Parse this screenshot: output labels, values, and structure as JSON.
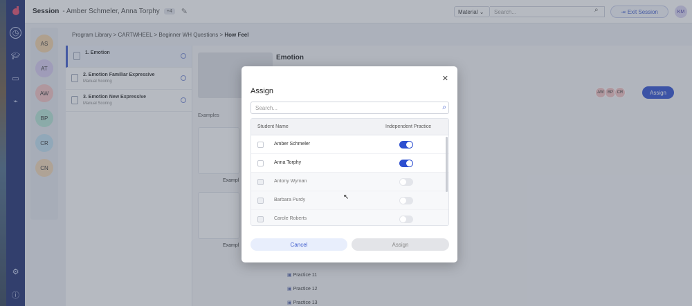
{
  "session": {
    "label": "Session",
    "students": "- Amber Schmeler, Anna Torphy",
    "extra": "+4"
  },
  "topbar": {
    "material": "Material",
    "search_placeholder": "Search...",
    "exit_label": "Exit Session",
    "user_initials": "KM"
  },
  "student_avatars": [
    {
      "initials": "AS",
      "color": "#f3d3a8"
    },
    {
      "initials": "AT",
      "color": "#d8ccf2"
    },
    {
      "initials": "AW",
      "color": "#f4c3c3"
    },
    {
      "initials": "BP",
      "color": "#b6e6d6"
    },
    {
      "initials": "CR",
      "color": "#bfe0f2"
    },
    {
      "initials": "CN",
      "color": "#f3d8b6"
    }
  ],
  "breadcrumb": {
    "parts": [
      "Program Library",
      "CARTWHEEL",
      "Beginner WH Questions"
    ],
    "current": "How Feel"
  },
  "targets": [
    {
      "title": "1. Emotion",
      "sub": ""
    },
    {
      "title": "2. Emotion Familiar Expressive",
      "sub": "Manual Scoring"
    },
    {
      "title": "3. Emotion New Expressive",
      "sub": "Manual Scoring"
    }
  ],
  "main": {
    "title": "Emotion",
    "examples_label": "Examples",
    "example_name": "Exampl",
    "assigned": [
      "AW",
      "BP",
      "CR"
    ],
    "assign_label": "Assign",
    "practices": [
      "Practice 11",
      "Practice 12",
      "Practice 13"
    ]
  },
  "modal": {
    "title": "Assign",
    "search_placeholder": "Search...",
    "col_student": "Student Name",
    "col_practice": "Independent Practice",
    "rows": [
      {
        "name": "Amber Schmeler",
        "on": true,
        "disabled": false
      },
      {
        "name": "Anna Torphy",
        "on": true,
        "disabled": false
      },
      {
        "name": "Antony Wyman",
        "on": false,
        "disabled": true
      },
      {
        "name": "Barbara Purdy",
        "on": false,
        "disabled": true
      },
      {
        "name": "Carole Roberts",
        "on": false,
        "disabled": true
      }
    ],
    "cancel_label": "Cancel",
    "assign_label": "Assign"
  },
  "colors": {
    "primary": "#2d4fd0",
    "rail": "#1c2b6e"
  }
}
